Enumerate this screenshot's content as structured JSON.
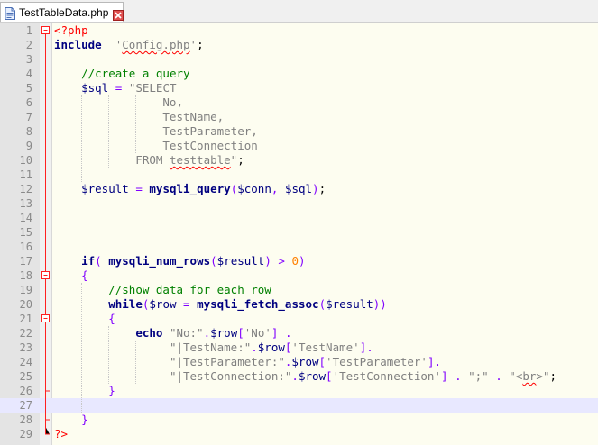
{
  "tab": {
    "title": "TestTableData.php",
    "close_icon": "close-icon"
  },
  "colors": {
    "editor_bg": "#fdfdf0",
    "keyword": "#000080",
    "string": "#808080",
    "comment": "#008000",
    "php_tag": "#ff0000",
    "current_line": "#e8e8ff"
  },
  "editor": {
    "current_line": 27,
    "lines": [
      {
        "n": "1",
        "fold": "open-top",
        "tokens": [
          [
            "php",
            "<?php"
          ]
        ]
      },
      {
        "n": "2",
        "fold": "line",
        "tokens": [
          [
            "kw",
            "include"
          ],
          [
            "",
            "  "
          ],
          [
            "str",
            "'"
          ],
          [
            "str sq",
            "Config.php"
          ],
          [
            "str",
            "'"
          ],
          [
            "",
            ";"
          ]
        ]
      },
      {
        "n": "3",
        "fold": "line",
        "tokens": []
      },
      {
        "n": "4",
        "fold": "line",
        "tokens": [
          [
            "",
            "    "
          ],
          [
            "cmt",
            "//create a query"
          ]
        ]
      },
      {
        "n": "5",
        "fold": "line",
        "tokens": [
          [
            "",
            "    "
          ],
          [
            "var",
            "$sql"
          ],
          [
            "",
            " "
          ],
          [
            "op",
            "="
          ],
          [
            "",
            " "
          ],
          [
            "str",
            "\"SELECT"
          ]
        ]
      },
      {
        "n": "6",
        "fold": "line",
        "tokens": [
          [
            "str",
            "                No,"
          ]
        ]
      },
      {
        "n": "7",
        "fold": "line",
        "tokens": [
          [
            "str",
            "                TestName,"
          ]
        ]
      },
      {
        "n": "8",
        "fold": "line",
        "tokens": [
          [
            "str",
            "                TestParameter,"
          ]
        ]
      },
      {
        "n": "9",
        "fold": "line",
        "tokens": [
          [
            "str",
            "                TestConnection"
          ]
        ]
      },
      {
        "n": "10",
        "fold": "line",
        "tokens": [
          [
            "str",
            "            FROM "
          ],
          [
            "str sq",
            "testtable"
          ],
          [
            "str",
            "\""
          ],
          [
            "",
            ";"
          ]
        ]
      },
      {
        "n": "11",
        "fold": "line",
        "tokens": []
      },
      {
        "n": "12",
        "fold": "line",
        "tokens": [
          [
            "",
            "    "
          ],
          [
            "var",
            "$result"
          ],
          [
            "",
            " "
          ],
          [
            "op",
            "="
          ],
          [
            "",
            " "
          ],
          [
            "fn",
            "mysqli_query"
          ],
          [
            "op",
            "("
          ],
          [
            "var",
            "$conn"
          ],
          [
            "op",
            ","
          ],
          [
            "",
            " "
          ],
          [
            "var",
            "$sql"
          ],
          [
            "op",
            ")"
          ],
          [
            "",
            ";"
          ]
        ]
      },
      {
        "n": "13",
        "fold": "line",
        "tokens": []
      },
      {
        "n": "14",
        "fold": "line",
        "tokens": []
      },
      {
        "n": "15",
        "fold": "line",
        "tokens": []
      },
      {
        "n": "16",
        "fold": "line",
        "tokens": []
      },
      {
        "n": "17",
        "fold": "line",
        "tokens": [
          [
            "",
            "    "
          ],
          [
            "kw",
            "if"
          ],
          [
            "op",
            "("
          ],
          [
            "",
            " "
          ],
          [
            "fn",
            "mysqli_num_rows"
          ],
          [
            "op",
            "("
          ],
          [
            "var",
            "$result"
          ],
          [
            "op",
            ")"
          ],
          [
            "",
            " "
          ],
          [
            "op",
            ">"
          ],
          [
            "",
            " "
          ],
          [
            "num",
            "0"
          ],
          [
            "op",
            ")"
          ]
        ]
      },
      {
        "n": "18",
        "fold": "open",
        "tokens": [
          [
            "",
            "    "
          ],
          [
            "op",
            "{"
          ]
        ]
      },
      {
        "n": "19",
        "fold": "line",
        "tokens": [
          [
            "",
            "        "
          ],
          [
            "cmt",
            "//show data for each row"
          ]
        ]
      },
      {
        "n": "20",
        "fold": "line",
        "tokens": [
          [
            "",
            "        "
          ],
          [
            "kw",
            "while"
          ],
          [
            "op",
            "("
          ],
          [
            "var",
            "$row"
          ],
          [
            "",
            " "
          ],
          [
            "op",
            "="
          ],
          [
            "",
            " "
          ],
          [
            "fn",
            "mysqli_fetch_assoc"
          ],
          [
            "op",
            "("
          ],
          [
            "var",
            "$result"
          ],
          [
            "op",
            "))"
          ]
        ]
      },
      {
        "n": "21",
        "fold": "open",
        "tokens": [
          [
            "",
            "        "
          ],
          [
            "op",
            "{"
          ]
        ]
      },
      {
        "n": "22",
        "fold": "line",
        "tokens": [
          [
            "",
            "            "
          ],
          [
            "kw",
            "echo"
          ],
          [
            "",
            " "
          ],
          [
            "str",
            "\"No:\""
          ],
          [
            "op",
            "."
          ],
          [
            "var",
            "$row"
          ],
          [
            "op",
            "["
          ],
          [
            "str",
            "'No'"
          ],
          [
            "op",
            "]"
          ],
          [
            "",
            " "
          ],
          [
            "op",
            "."
          ]
        ]
      },
      {
        "n": "23",
        "fold": "line",
        "tokens": [
          [
            "",
            "                 "
          ],
          [
            "str",
            "\"|TestName:\""
          ],
          [
            "op",
            "."
          ],
          [
            "var",
            "$row"
          ],
          [
            "op",
            "["
          ],
          [
            "str",
            "'TestName'"
          ],
          [
            "op",
            "]."
          ]
        ]
      },
      {
        "n": "24",
        "fold": "line",
        "tokens": [
          [
            "",
            "                 "
          ],
          [
            "str",
            "\"|TestParameter:\""
          ],
          [
            "op",
            "."
          ],
          [
            "var",
            "$row"
          ],
          [
            "op",
            "["
          ],
          [
            "str",
            "'TestParameter'"
          ],
          [
            "op",
            "]."
          ]
        ]
      },
      {
        "n": "25",
        "fold": "line",
        "tokens": [
          [
            "",
            "                 "
          ],
          [
            "str",
            "\"|TestConnection:\""
          ],
          [
            "op",
            "."
          ],
          [
            "var",
            "$row"
          ],
          [
            "op",
            "["
          ],
          [
            "str",
            "'TestConnection'"
          ],
          [
            "op",
            "]"
          ],
          [
            "",
            " "
          ],
          [
            "op",
            "."
          ],
          [
            "",
            " "
          ],
          [
            "str",
            "\";\""
          ],
          [
            "",
            " "
          ],
          [
            "op",
            "."
          ],
          [
            "",
            " "
          ],
          [
            "str",
            "\"<"
          ],
          [
            "str sq",
            "br"
          ],
          [
            "str",
            ">\""
          ],
          [
            "",
            ";"
          ]
        ]
      },
      {
        "n": "26",
        "fold": "close",
        "tokens": [
          [
            "",
            "        "
          ],
          [
            "op",
            "}"
          ]
        ]
      },
      {
        "n": "27",
        "fold": "line",
        "tokens": []
      },
      {
        "n": "28",
        "fold": "close",
        "tokens": [
          [
            "",
            "    "
          ],
          [
            "op",
            "}"
          ]
        ]
      },
      {
        "n": "29",
        "fold": "end",
        "tokens": [
          [
            "php",
            "?>"
          ]
        ]
      }
    ]
  }
}
